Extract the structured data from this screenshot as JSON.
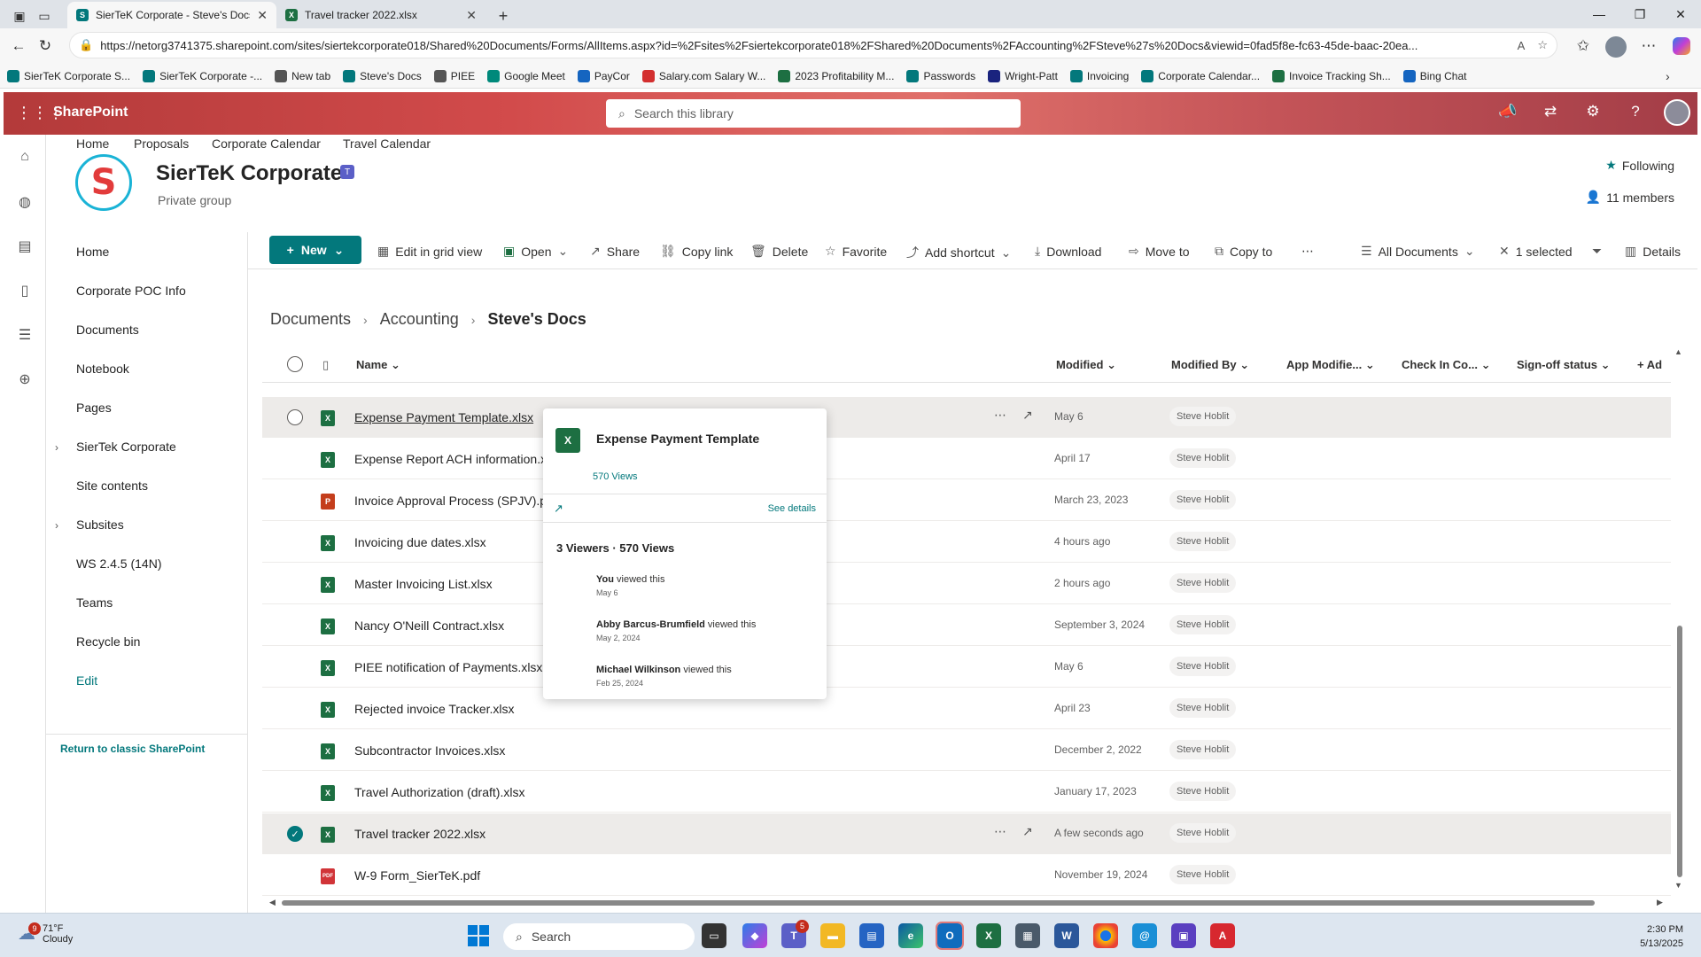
{
  "browser": {
    "tabs": [
      {
        "title": "SierTeK Corporate - Steve's Docs",
        "active": true
      },
      {
        "title": "Travel tracker 2022.xlsx",
        "active": false
      }
    ],
    "url": "https://netorg3741375.sharepoint.com/sites/siertekcorporate018/Shared%20Documents/Forms/AllItems.aspx?id=%2Fsites%2Fsiertekcorporate018%2FShared%20Documents%2FAccounting%2FSteve%27s%20Docs&viewid=0fad5f8e-fc63-45de-baac-20ea...",
    "bookmarks": [
      {
        "label": "SierTeK Corporate S...",
        "icon": "sharepoint-icon",
        "color": "#03787c"
      },
      {
        "label": "SierTeK Corporate -...",
        "icon": "sharepoint-icon",
        "color": "#03787c"
      },
      {
        "label": "New tab",
        "icon": "newtab-icon",
        "color": "#555555"
      },
      {
        "label": "Steve's Docs",
        "icon": "sharepoint-icon",
        "color": "#03787c"
      },
      {
        "label": "PIEE",
        "icon": "folder-icon",
        "color": "#555555"
      },
      {
        "label": "Google Meet",
        "icon": "meet-icon",
        "color": "#00897b"
      },
      {
        "label": "PayCor",
        "icon": "paycor-icon",
        "color": "#1565c0"
      },
      {
        "label": "Salary.com Salary W...",
        "icon": "salary-icon",
        "color": "#d32f2f"
      },
      {
        "label": "2023 Profitability M...",
        "icon": "excel-icon",
        "color": "#1d6f42"
      },
      {
        "label": "Passwords",
        "icon": "sharepoint-icon",
        "color": "#03787c"
      },
      {
        "label": "Wright-Patt",
        "icon": "wrightpatt-icon",
        "color": "#1a237e"
      },
      {
        "label": "Invoicing",
        "icon": "sharepoint-icon",
        "color": "#03787c"
      },
      {
        "label": "Corporate Calendar...",
        "icon": "sharepoint-icon",
        "color": "#03787c"
      },
      {
        "label": "Invoice Tracking Sh...",
        "icon": "excel-icon",
        "color": "#1d6f42"
      },
      {
        "label": "Bing Chat",
        "icon": "search-icon",
        "color": "#1565c0"
      }
    ]
  },
  "sp": {
    "brand": "SharePoint",
    "search_placeholder": "Search this library"
  },
  "site": {
    "topnav": [
      "Home",
      "Proposals",
      "Corporate Calendar",
      "Travel Calendar"
    ],
    "logo_letter": "S",
    "title": "SierTeK Corporate",
    "subtitle": "Private group",
    "following": "Following",
    "members": "11 members"
  },
  "leftnav": {
    "items": [
      "Home",
      "Corporate POC Info",
      "Documents",
      "Notebook",
      "Pages",
      "SierTek Corporate",
      "Site contents",
      "Subsites",
      "WS 2.4.5 (14N)",
      "Teams",
      "Recycle bin"
    ],
    "edit": "Edit",
    "classic": "Return to classic SharePoint"
  },
  "cmdbar": {
    "new": "New",
    "edit_grid": "Edit in grid view",
    "open": "Open",
    "share": "Share",
    "copy_link": "Copy link",
    "delete": "Delete",
    "favorite": "Favorite",
    "add_shortcut": "Add shortcut",
    "download": "Download",
    "move_to": "Move to",
    "copy_to": "Copy to",
    "view": "All Documents",
    "selected": "1 selected",
    "details": "Details"
  },
  "breadcrumb": [
    "Documents",
    "Accounting",
    "Steve's Docs"
  ],
  "columns": {
    "name": "Name",
    "modified": "Modified",
    "modified_by": "Modified By",
    "app_modified": "App Modifie...",
    "check_in": "Check In Co...",
    "signoff": "Sign-off status",
    "add": "Ad"
  },
  "files": [
    {
      "name": "Expense Payment Template.xlsx",
      "type": "x",
      "modified": "May 6",
      "by": "Steve Hoblit"
    },
    {
      "name": "Expense Report ACH information.xlsx",
      "type": "x",
      "modified": "April 17",
      "by": "Steve Hoblit"
    },
    {
      "name": "Invoice Approval Process (SPJV).pptx",
      "type": "p",
      "modified": "March 23, 2023",
      "by": "Steve Hoblit"
    },
    {
      "name": "Invoicing due dates.xlsx",
      "type": "x",
      "modified": "4 hours ago",
      "by": "Steve Hoblit"
    },
    {
      "name": "Master Invoicing List.xlsx",
      "type": "x",
      "modified": "2 hours ago",
      "by": "Steve Hoblit"
    },
    {
      "name": "Nancy O'Neill Contract.xlsx",
      "type": "x",
      "modified": "September 3, 2024",
      "by": "Steve Hoblit"
    },
    {
      "name": "PIEE notification of Payments.xlsx",
      "type": "x",
      "modified": "May 6",
      "by": "Steve Hoblit"
    },
    {
      "name": "Rejected invoice Tracker.xlsx",
      "type": "x",
      "modified": "April 23",
      "by": "Steve Hoblit"
    },
    {
      "name": "Subcontractor Invoices.xlsx",
      "type": "x",
      "modified": "December 2, 2022",
      "by": "Steve Hoblit"
    },
    {
      "name": "Travel Authorization (draft).xlsx",
      "type": "x",
      "modified": "January 17, 2023",
      "by": "Steve Hoblit"
    },
    {
      "name": "Travel tracker 2022.xlsx",
      "type": "x",
      "modified": "A few seconds ago",
      "by": "Steve Hoblit"
    },
    {
      "name": "W-9 Form_SierTeK.pdf",
      "type": "f",
      "modified": "November 19, 2024",
      "by": "Steve Hoblit"
    }
  ],
  "hovercard": {
    "title": "Expense Payment Template",
    "views": "570 Views",
    "see_details": "See details",
    "summary": "3 Viewers · 570 Views",
    "viewers": [
      {
        "name": "You",
        "action": " viewed this",
        "date": "May 6"
      },
      {
        "name": "Abby Barcus-Brumfield",
        "action": " viewed this",
        "date": "May 2, 2024"
      },
      {
        "name": "Michael Wilkinson",
        "action": " viewed this",
        "date": "Feb 25, 2024"
      }
    ]
  },
  "taskbar": {
    "temp": "71°F",
    "condition": "Cloudy",
    "weather_badge": "9",
    "search": "Search",
    "teams_badge": "5",
    "time": "2:30 PM",
    "date": "5/13/2025"
  }
}
